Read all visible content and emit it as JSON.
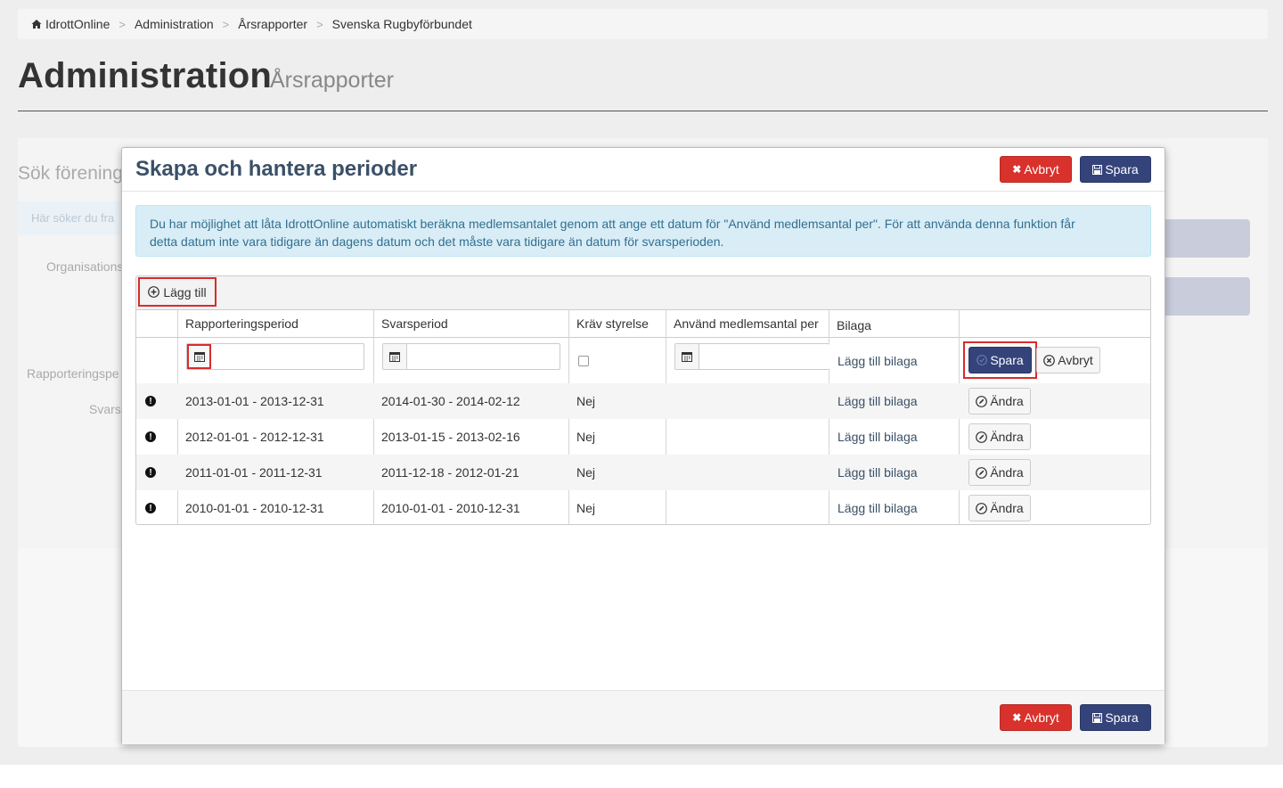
{
  "breadcrumb": {
    "items": [
      "IdrottOnline",
      "Administration",
      "Årsrapporter",
      "Svenska Rugbyförbundet"
    ],
    "separator": ">"
  },
  "header": {
    "title": "Administration",
    "subtitle": "Årsrapporter"
  },
  "background": {
    "search_title": "Sök förening",
    "search_hint": "Här söker du fra",
    "label_organisation": "Organisations",
    "label_period": "Rapporteringspe",
    "label_svar": "Svars"
  },
  "modal": {
    "title": "Skapa och hantera perioder",
    "cancel_label": "Avbryt",
    "save_label": "Spara",
    "info_text_1": "Du har möjlighet att låta IdrottOnline automatiskt beräkna medlemsantalet genom att ange ett datum för \"Använd medlemsantal per\". För att använda denna funktion får",
    "info_text_2": "detta datum inte vara tidigare än dagens datum och det måste vara tidigare än datum för svarsperioden.",
    "grid": {
      "add_label": "Lägg till",
      "columns": [
        "Rapporteringsperiod",
        "Svarsperiod",
        "Kräv styrelse",
        "Använd medlemsantal per",
        "Bilaga"
      ],
      "new_row": {
        "attachment_link": "Lägg till bilaga",
        "save_label": "Spara",
        "cancel_label": "Avbryt"
      },
      "rows": [
        {
          "period": "2013-01-01 - 2013-12-31",
          "reply": "2014-01-30 - 2014-02-12",
          "board": "Nej",
          "members": "",
          "attachment": "Lägg till bilaga",
          "edit": "Ändra"
        },
        {
          "period": "2012-01-01 - 2012-12-31",
          "reply": "2013-01-15 - 2013-02-16",
          "board": "Nej",
          "members": "",
          "attachment": "Lägg till bilaga",
          "edit": "Ändra"
        },
        {
          "period": "2011-01-01 - 2011-12-31",
          "reply": "2011-12-18 - 2012-01-21",
          "board": "Nej",
          "members": "",
          "attachment": "Lägg till bilaga",
          "edit": "Ändra"
        },
        {
          "period": "2010-01-01 - 2010-12-31",
          "reply": "2010-01-01 - 2010-12-31",
          "board": "Nej",
          "members": "",
          "attachment": "Lägg till bilaga",
          "edit": "Ändra"
        }
      ]
    }
  },
  "colors": {
    "danger": "#d9312b",
    "primary": "#34437a",
    "highlight": "#d92b2b",
    "info_bg": "#d9edf7",
    "title": "#3b5068"
  }
}
